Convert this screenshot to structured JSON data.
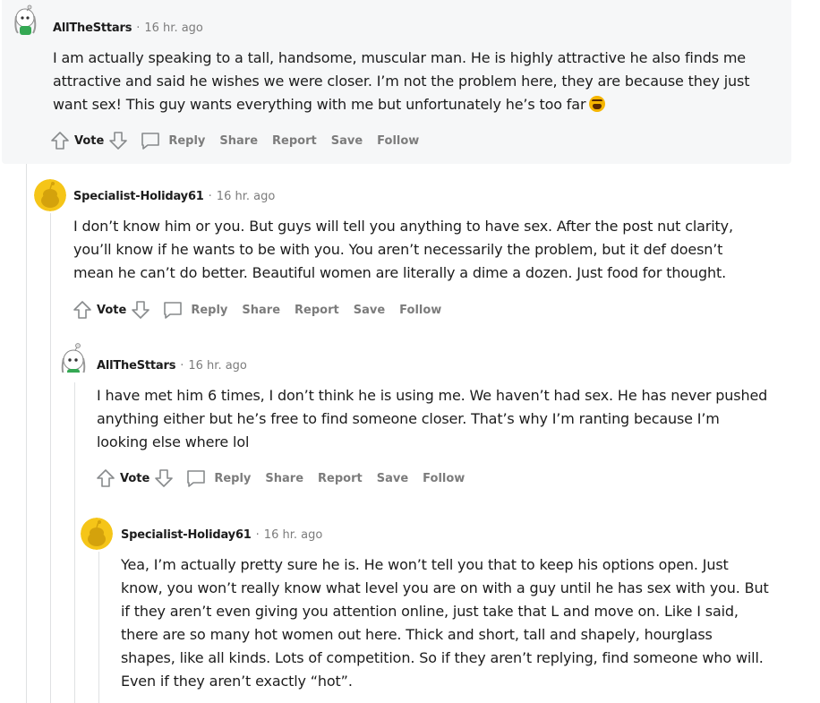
{
  "action_labels": {
    "vote": "Vote",
    "reply": "Reply",
    "share": "Share",
    "report": "Report",
    "save": "Save",
    "follow": "Follow"
  },
  "comments": [
    {
      "username": "AllTheSttars",
      "separator": "·",
      "time": "16 hr. ago",
      "lines": [
        "I am actually speaking to a tall, handsome, muscular man. He is highly attractive he also finds me",
        "attractive and said he wishes we were closer. I’m not the problem here, they are because they just",
        "want sex! This guy wants everything with me but unfortunately he’s too far"
      ],
      "emoji": "weary-face-emoji",
      "highlighted": true
    },
    {
      "username": "Specialist-Holiday61",
      "separator": "·",
      "time": "16 hr. ago",
      "lines": [
        "I don’t know him or you. But guys will tell you anything to have sex. After the post nut clarity,",
        "you’ll know if he wants to be with you. You aren’t necessarily the problem, but it def doesn’t",
        "mean he can’t do better. Beautiful women are literally a dime a dozen. Just food for thought."
      ]
    },
    {
      "username": "AllTheSttars",
      "separator": "·",
      "time": "16 hr. ago",
      "lines": [
        "I have met him 6 times, I don’t think he is using me. We haven’t had sex. He has never pushed",
        "anything either but he’s free to find someone closer. That’s why I’m ranting because I’m",
        "looking else where lol"
      ]
    },
    {
      "username": "Specialist-Holiday61",
      "separator": "·",
      "time": "16 hr. ago",
      "lines": [
        "Yea, I’m actually pretty sure he is. He won’t tell you that to keep his options open. Just",
        "know, you won’t really know what level you are on with a guy until he has sex with you. But",
        "if they aren’t even giving you attention online, just take that L and move on. Like I said,",
        "there are so many hot women out here. Thick and short, tall and shapely, hourglass",
        "shapes, like all kinds. Lots of competition. So if they aren’t replying, find someone who will.",
        "Even if they aren’t exactly “hot”."
      ]
    }
  ],
  "colors": {
    "highlight_bg": "#f6f7f8",
    "meta_text": "#7c7c7c",
    "thread_line": "#dfe1e3",
    "snoo_avatar_bg": "#f5c518"
  }
}
